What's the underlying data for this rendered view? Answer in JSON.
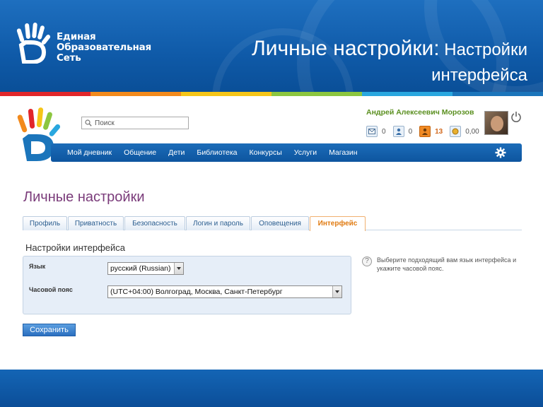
{
  "banner": {
    "logo_line1": "Единая",
    "logo_line2": "Образовательная",
    "logo_line3": "Сеть",
    "title_main": "Личные настройки:",
    "title_sub": " Настройки интерфейса"
  },
  "colors": {
    "banner_blue": "#1465b5",
    "accent_green": "#5a8f1f",
    "title_purple": "#7a3b7a",
    "active_tab_orange": "#e07a10",
    "stripe": [
      "#e1262a",
      "#f28a1c",
      "#f5c518",
      "#8cc63f",
      "#29a7df",
      "#1b75bb"
    ]
  },
  "header": {
    "search_placeholder": "Поиск",
    "user_name": "Андрей Алексеевич Морозов",
    "counters": [
      {
        "icon": "mail-icon",
        "value": "0"
      },
      {
        "icon": "friends-icon",
        "value": "0"
      },
      {
        "icon": "notifications-icon",
        "value": "13"
      },
      {
        "icon": "money-icon",
        "value": "0,00"
      }
    ]
  },
  "nav": {
    "items": [
      "Мой дневник",
      "Общение",
      "Дети",
      "Библиотека",
      "Конкурсы",
      "Услуги",
      "Магазин"
    ]
  },
  "main": {
    "page_title": "Личные настройки",
    "tabs": [
      "Профиль",
      "Приватность",
      "Безопасность",
      "Логин и пароль",
      "Оповещения",
      "Интерфейс"
    ],
    "active_tab": "Интерфейс",
    "section_title": "Настройки интерфейса",
    "language_label": "Язык",
    "language_value": "русский (Russian)",
    "timezone_label": "Часовой пояс",
    "timezone_value": "(UTC+04:00) Волгоград, Москва, Санкт-Петербург",
    "help_text": "Выберите подходящий вам язык интерфейса и укажите часовой пояс.",
    "help_icon_glyph": "?",
    "save_label": "Сохранить"
  }
}
